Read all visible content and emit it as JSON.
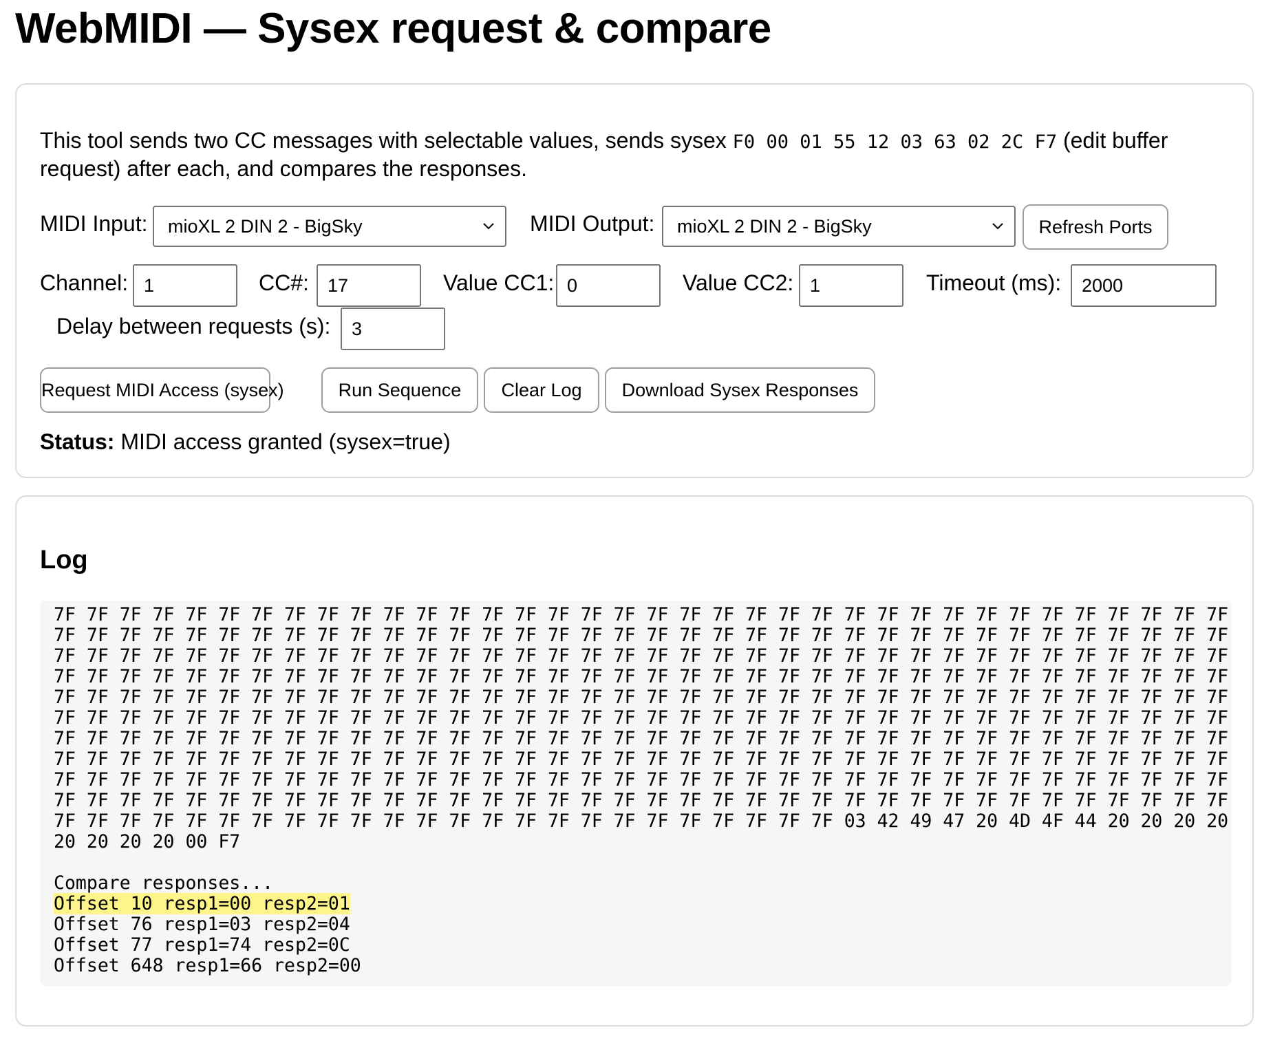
{
  "page": {
    "title": "WebMIDI — Sysex request & compare"
  },
  "intro": {
    "text_before": "This tool sends two CC messages with selectable values, sends sysex ",
    "sysex_code": "F0 00 01 55 12 03 63 02 2C F7",
    "text_after": " (edit buffer request) after each, and compares the responses."
  },
  "ports": {
    "input_label": "MIDI Input:",
    "input_value": "mioXL 2 DIN 2 - BigSky",
    "output_label": "MIDI Output:",
    "output_value": "mioXL 2 DIN 2 - BigSky",
    "refresh_label": "Refresh Ports"
  },
  "params": {
    "channel_label": "Channel:",
    "channel_value": "1",
    "cc_label": "CC#:",
    "cc_value": "17",
    "cc1_label": "Value CC1:",
    "cc1_value": "0",
    "cc2_label": "Value CC2:",
    "cc2_value": "1",
    "timeout_label": "Timeout (ms):",
    "timeout_value": "2000",
    "delay_label": "Delay between requests (s):",
    "delay_value": "3"
  },
  "actions": {
    "request_access": "Request MIDI Access (sysex)",
    "run_sequence": "Run Sequence",
    "clear_log": "Clear Log",
    "download": "Download Sysex Responses"
  },
  "status": {
    "label": "Status:",
    "text": "MIDI access granted (sysex=true)"
  },
  "log": {
    "title": "Log",
    "lines": [
      "7F 7F 7F 7F 7F 7F 7F 7F 7F 7F 7F 7F 7F 7F 7F 7F 7F 7F 7F 7F 7F 7F 7F 7F 7F 7F 7F 7F 7F 7F 7F 7F 7F 7F 7F 7F",
      "7F 7F 7F 7F 7F 7F 7F 7F 7F 7F 7F 7F 7F 7F 7F 7F 7F 7F 7F 7F 7F 7F 7F 7F 7F 7F 7F 7F 7F 7F 7F 7F 7F 7F 7F 7F",
      "7F 7F 7F 7F 7F 7F 7F 7F 7F 7F 7F 7F 7F 7F 7F 7F 7F 7F 7F 7F 7F 7F 7F 7F 7F 7F 7F 7F 7F 7F 7F 7F 7F 7F 7F 7F",
      "7F 7F 7F 7F 7F 7F 7F 7F 7F 7F 7F 7F 7F 7F 7F 7F 7F 7F 7F 7F 7F 7F 7F 7F 7F 7F 7F 7F 7F 7F 7F 7F 7F 7F 7F 7F",
      "7F 7F 7F 7F 7F 7F 7F 7F 7F 7F 7F 7F 7F 7F 7F 7F 7F 7F 7F 7F 7F 7F 7F 7F 7F 7F 7F 7F 7F 7F 7F 7F 7F 7F 7F 7F",
      "7F 7F 7F 7F 7F 7F 7F 7F 7F 7F 7F 7F 7F 7F 7F 7F 7F 7F 7F 7F 7F 7F 7F 7F 7F 7F 7F 7F 7F 7F 7F 7F 7F 7F 7F 7F",
      "7F 7F 7F 7F 7F 7F 7F 7F 7F 7F 7F 7F 7F 7F 7F 7F 7F 7F 7F 7F 7F 7F 7F 7F 7F 7F 7F 7F 7F 7F 7F 7F 7F 7F 7F 7F",
      "7F 7F 7F 7F 7F 7F 7F 7F 7F 7F 7F 7F 7F 7F 7F 7F 7F 7F 7F 7F 7F 7F 7F 7F 7F 7F 7F 7F 7F 7F 7F 7F 7F 7F 7F 7F",
      "7F 7F 7F 7F 7F 7F 7F 7F 7F 7F 7F 7F 7F 7F 7F 7F 7F 7F 7F 7F 7F 7F 7F 7F 7F 7F 7F 7F 7F 7F 7F 7F 7F 7F 7F 7F",
      "7F 7F 7F 7F 7F 7F 7F 7F 7F 7F 7F 7F 7F 7F 7F 7F 7F 7F 7F 7F 7F 7F 7F 7F 7F 7F 7F 7F 7F 7F 7F 7F 7F 7F 7F 7F",
      "7F 7F 7F 7F 7F 7F 7F 7F 7F 7F 7F 7F 7F 7F 7F 7F 7F 7F 7F 7F 7F 7F 7F 7F 03 42 49 47 20 4D 4F 44 20 20 20 20 20",
      "20 20 20 20 00 F7",
      "",
      "Compare responses...",
      "Offset 10 resp1=00 resp2=01",
      "Offset 76 resp1=03 resp2=04",
      "Offset 77 resp1=74 resp2=0C",
      "Offset 648 resp1=66 resp2=00"
    ],
    "highlighted_line": "Offset 10 resp1=00 resp2=01",
    "highlight_color": "#fdf58a"
  }
}
